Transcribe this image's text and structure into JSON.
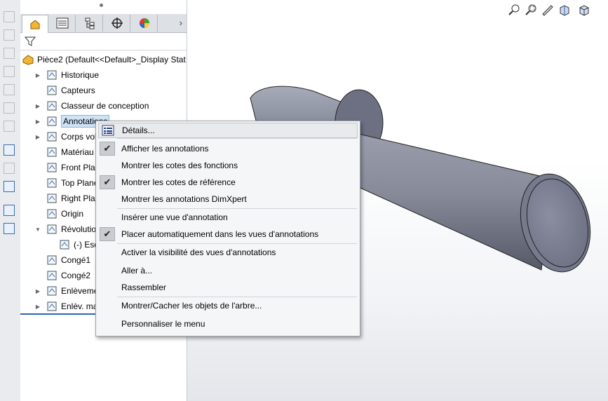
{
  "tree": {
    "root": "Pièce2  (Default<<Default>_Display Stat",
    "items": [
      {
        "label": "Historique",
        "icon": "history-icon",
        "expander": "▶"
      },
      {
        "label": "Capteurs",
        "icon": "sensor-icon",
        "expander": ""
      },
      {
        "label": "Classeur de conception",
        "icon": "binder-icon",
        "expander": "▶"
      },
      {
        "label": "Annotations",
        "icon": "annotation-icon",
        "expander": "▶"
      },
      {
        "label": "Corps volumiques",
        "icon": "solid-bodies-icon",
        "expander": "▶"
      },
      {
        "label": "Matériau <",
        "icon": "material-icon",
        "expander": ""
      },
      {
        "label": "Front Plane",
        "icon": "plane-icon",
        "expander": ""
      },
      {
        "label": "Top Plane",
        "icon": "plane-icon",
        "expander": ""
      },
      {
        "label": "Right Plane",
        "icon": "plane-icon",
        "expander": ""
      },
      {
        "label": "Origin",
        "icon": "origin-icon",
        "expander": ""
      },
      {
        "label": "Révolution1",
        "icon": "revolve-icon",
        "expander": "▼"
      },
      {
        "label": "(-) Esquisse1",
        "icon": "sketch-icon",
        "expander": ""
      },
      {
        "label": "Congé1",
        "icon": "fillet-icon",
        "expander": ""
      },
      {
        "label": "Congé2",
        "icon": "fillet-icon",
        "expander": ""
      },
      {
        "label": "Enlèvement de matière",
        "icon": "cut-icon",
        "expander": "▶"
      },
      {
        "label": "Enlèv. mat.",
        "icon": "cut-icon",
        "expander": "▶"
      }
    ]
  },
  "context_menu": {
    "items": [
      {
        "label": "Détails...",
        "icon": "details-icon",
        "checked": false
      },
      {
        "label": "Afficher les annotations",
        "checked": true
      },
      {
        "label": "Montrer les cotes des fonctions",
        "checked": false
      },
      {
        "label": "Montrer les cotes de référence",
        "checked": true
      },
      {
        "label": "Montrer les annotations DimXpert",
        "checked": false
      },
      {
        "label": "Insérer une vue d'annotation",
        "checked": false
      },
      {
        "label": "Placer automatiquement dans les vues d'annotations",
        "checked": true
      },
      {
        "label": "Activer la visibilité des vues d'annotations",
        "checked": false
      },
      {
        "label": "Aller à...",
        "checked": false
      },
      {
        "label": "Rassembler",
        "checked": false
      },
      {
        "label": "Montrer/Cacher les objets de l'arbre...",
        "checked": false
      },
      {
        "label": "Personnaliser le menu",
        "checked": false
      }
    ],
    "check_glyph": "✔"
  },
  "colors": {
    "selection": "#cfe3f7",
    "rollback_bar": "#2f63b8",
    "model_gray": "#8e93a2"
  }
}
